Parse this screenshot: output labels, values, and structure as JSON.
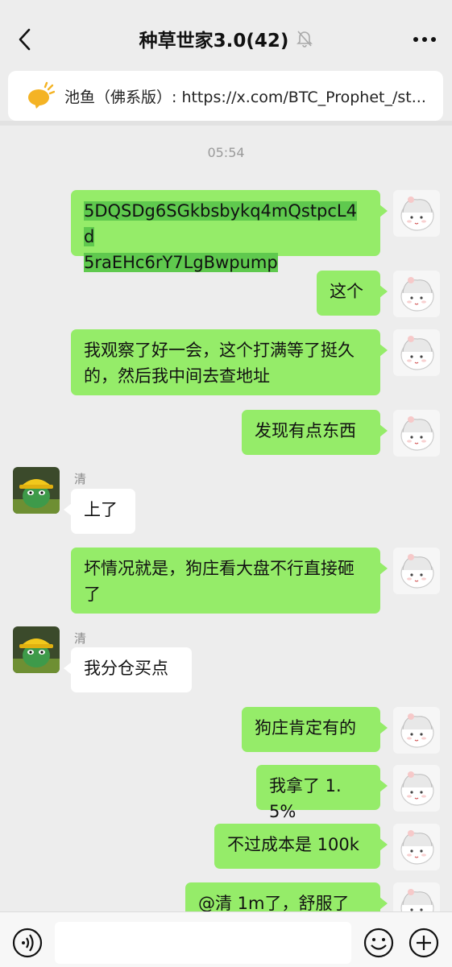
{
  "header": {
    "back_icon": "chevron-left-icon",
    "title": "种草世家3.0(42)",
    "mute_icon": "bell-off-icon",
    "more_icon": "more-dots-icon"
  },
  "pinned": {
    "icon": "megaphone-icon",
    "text": "池鱼（佛系版）: https://x.com/BTC_Prophet_/st..."
  },
  "timestamp": "05:54",
  "messages": [
    {
      "from": "me",
      "text_line1": "5DQSDg6SGkbsbykq4mQstpcL4d",
      "text_line2": "5raEHc6rY7LgBwpump"
    },
    {
      "from": "me",
      "text": "这个"
    },
    {
      "from": "me",
      "text": "我观察了好一会，这个打满等了挺久的，然后我中间去查地址"
    },
    {
      "from": "me",
      "text": "发现有点东西"
    },
    {
      "from": "other",
      "sender": "清",
      "text": "上了"
    },
    {
      "from": "me",
      "text": "坏情况就是，狗庄看大盘不行直接砸了"
    },
    {
      "from": "other",
      "sender": "清",
      "text": "我分仓买点"
    },
    {
      "from": "me",
      "text": "狗庄肯定有的"
    },
    {
      "from": "me",
      "text": "我拿了 1.5%"
    },
    {
      "from": "me",
      "text": "不过成本是 100k"
    },
    {
      "from": "me",
      "text": "@清  1m了，舒服了"
    }
  ],
  "inputbar": {
    "voice_icon": "voice-icon",
    "emoji_icon": "emoji-icon",
    "plus_icon": "plus-circle-icon"
  }
}
